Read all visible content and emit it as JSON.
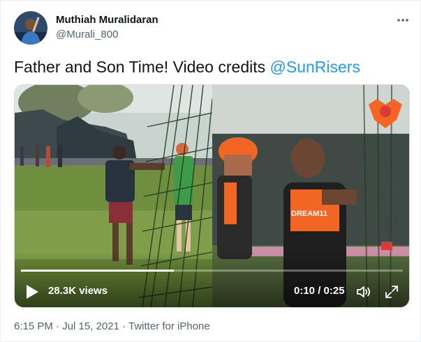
{
  "author": {
    "name": "Muthiah Muralidaran",
    "handle": "@Murali_800"
  },
  "tweet": {
    "text": "Father and Son Time! Video credits ",
    "mention": "@SunRisers"
  },
  "video": {
    "views": "28.3K views",
    "current_time": "0:10",
    "duration": "0:25",
    "progress_fraction": 0.4
  },
  "meta": {
    "time": "6:15 PM",
    "separator": " · ",
    "date": "Jul 15, 2021",
    "source": "Twitter for iPhone"
  },
  "colors": {
    "link": "#1d9bf0",
    "secondary_text": "#536471",
    "primary_text": "#0f1419",
    "team_orange": "#f26522"
  },
  "icons": {
    "more": "more-horizontal-icon",
    "play": "play-icon",
    "volume": "volume-icon",
    "fullscreen": "fullscreen-icon"
  }
}
